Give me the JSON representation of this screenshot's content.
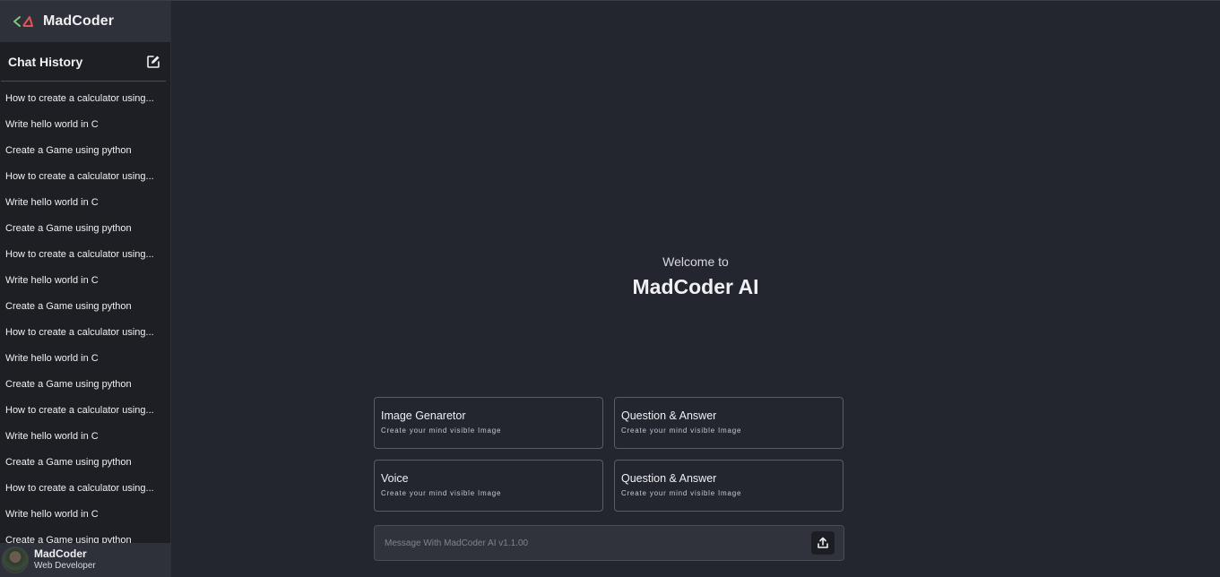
{
  "sidebar": {
    "brand": {
      "name": "MadCoder",
      "logo_icon": "code-logo-icon"
    },
    "history_title": "Chat History",
    "new_chat_icon": "edit-icon",
    "history": [
      "How to create a calculator using...",
      "Write hello world in C",
      "Create a Game using python",
      "How to create a calculator using...",
      "Write hello world in C",
      "Create a Game using python",
      "How to create a calculator using...",
      "Write hello world in C",
      "Create a Game using python",
      "How to create a calculator using...",
      "Write hello world in C",
      "Create a Game using python",
      "How to create a calculator using...",
      "Write hello world in C",
      "Create a Game using python",
      "How to create a calculator using...",
      "Write hello world in C",
      "Create a Game using python"
    ],
    "profile": {
      "name": "MadCoder",
      "role": "Web Developer"
    }
  },
  "main": {
    "welcome_small": "Welcome to",
    "welcome_big": "MadCoder AI",
    "cards": [
      {
        "title": "Image Genaretor",
        "subtitle": "Create your mind visible Image"
      },
      {
        "title": "Question & Answer",
        "subtitle": "Create your mind visible Image"
      },
      {
        "title": "Voice",
        "subtitle": "Create your mind visible Image"
      },
      {
        "title": "Question & Answer",
        "subtitle": "Create your mind visible Image"
      }
    ],
    "composer": {
      "placeholder": "Message With MadCoder AI v1.1.00",
      "send_icon": "upload-icon"
    }
  },
  "colors": {
    "background": "#23262e",
    "sidebar": "#1d1f24",
    "panel": "#2e3139",
    "border": "#5a5d66"
  }
}
